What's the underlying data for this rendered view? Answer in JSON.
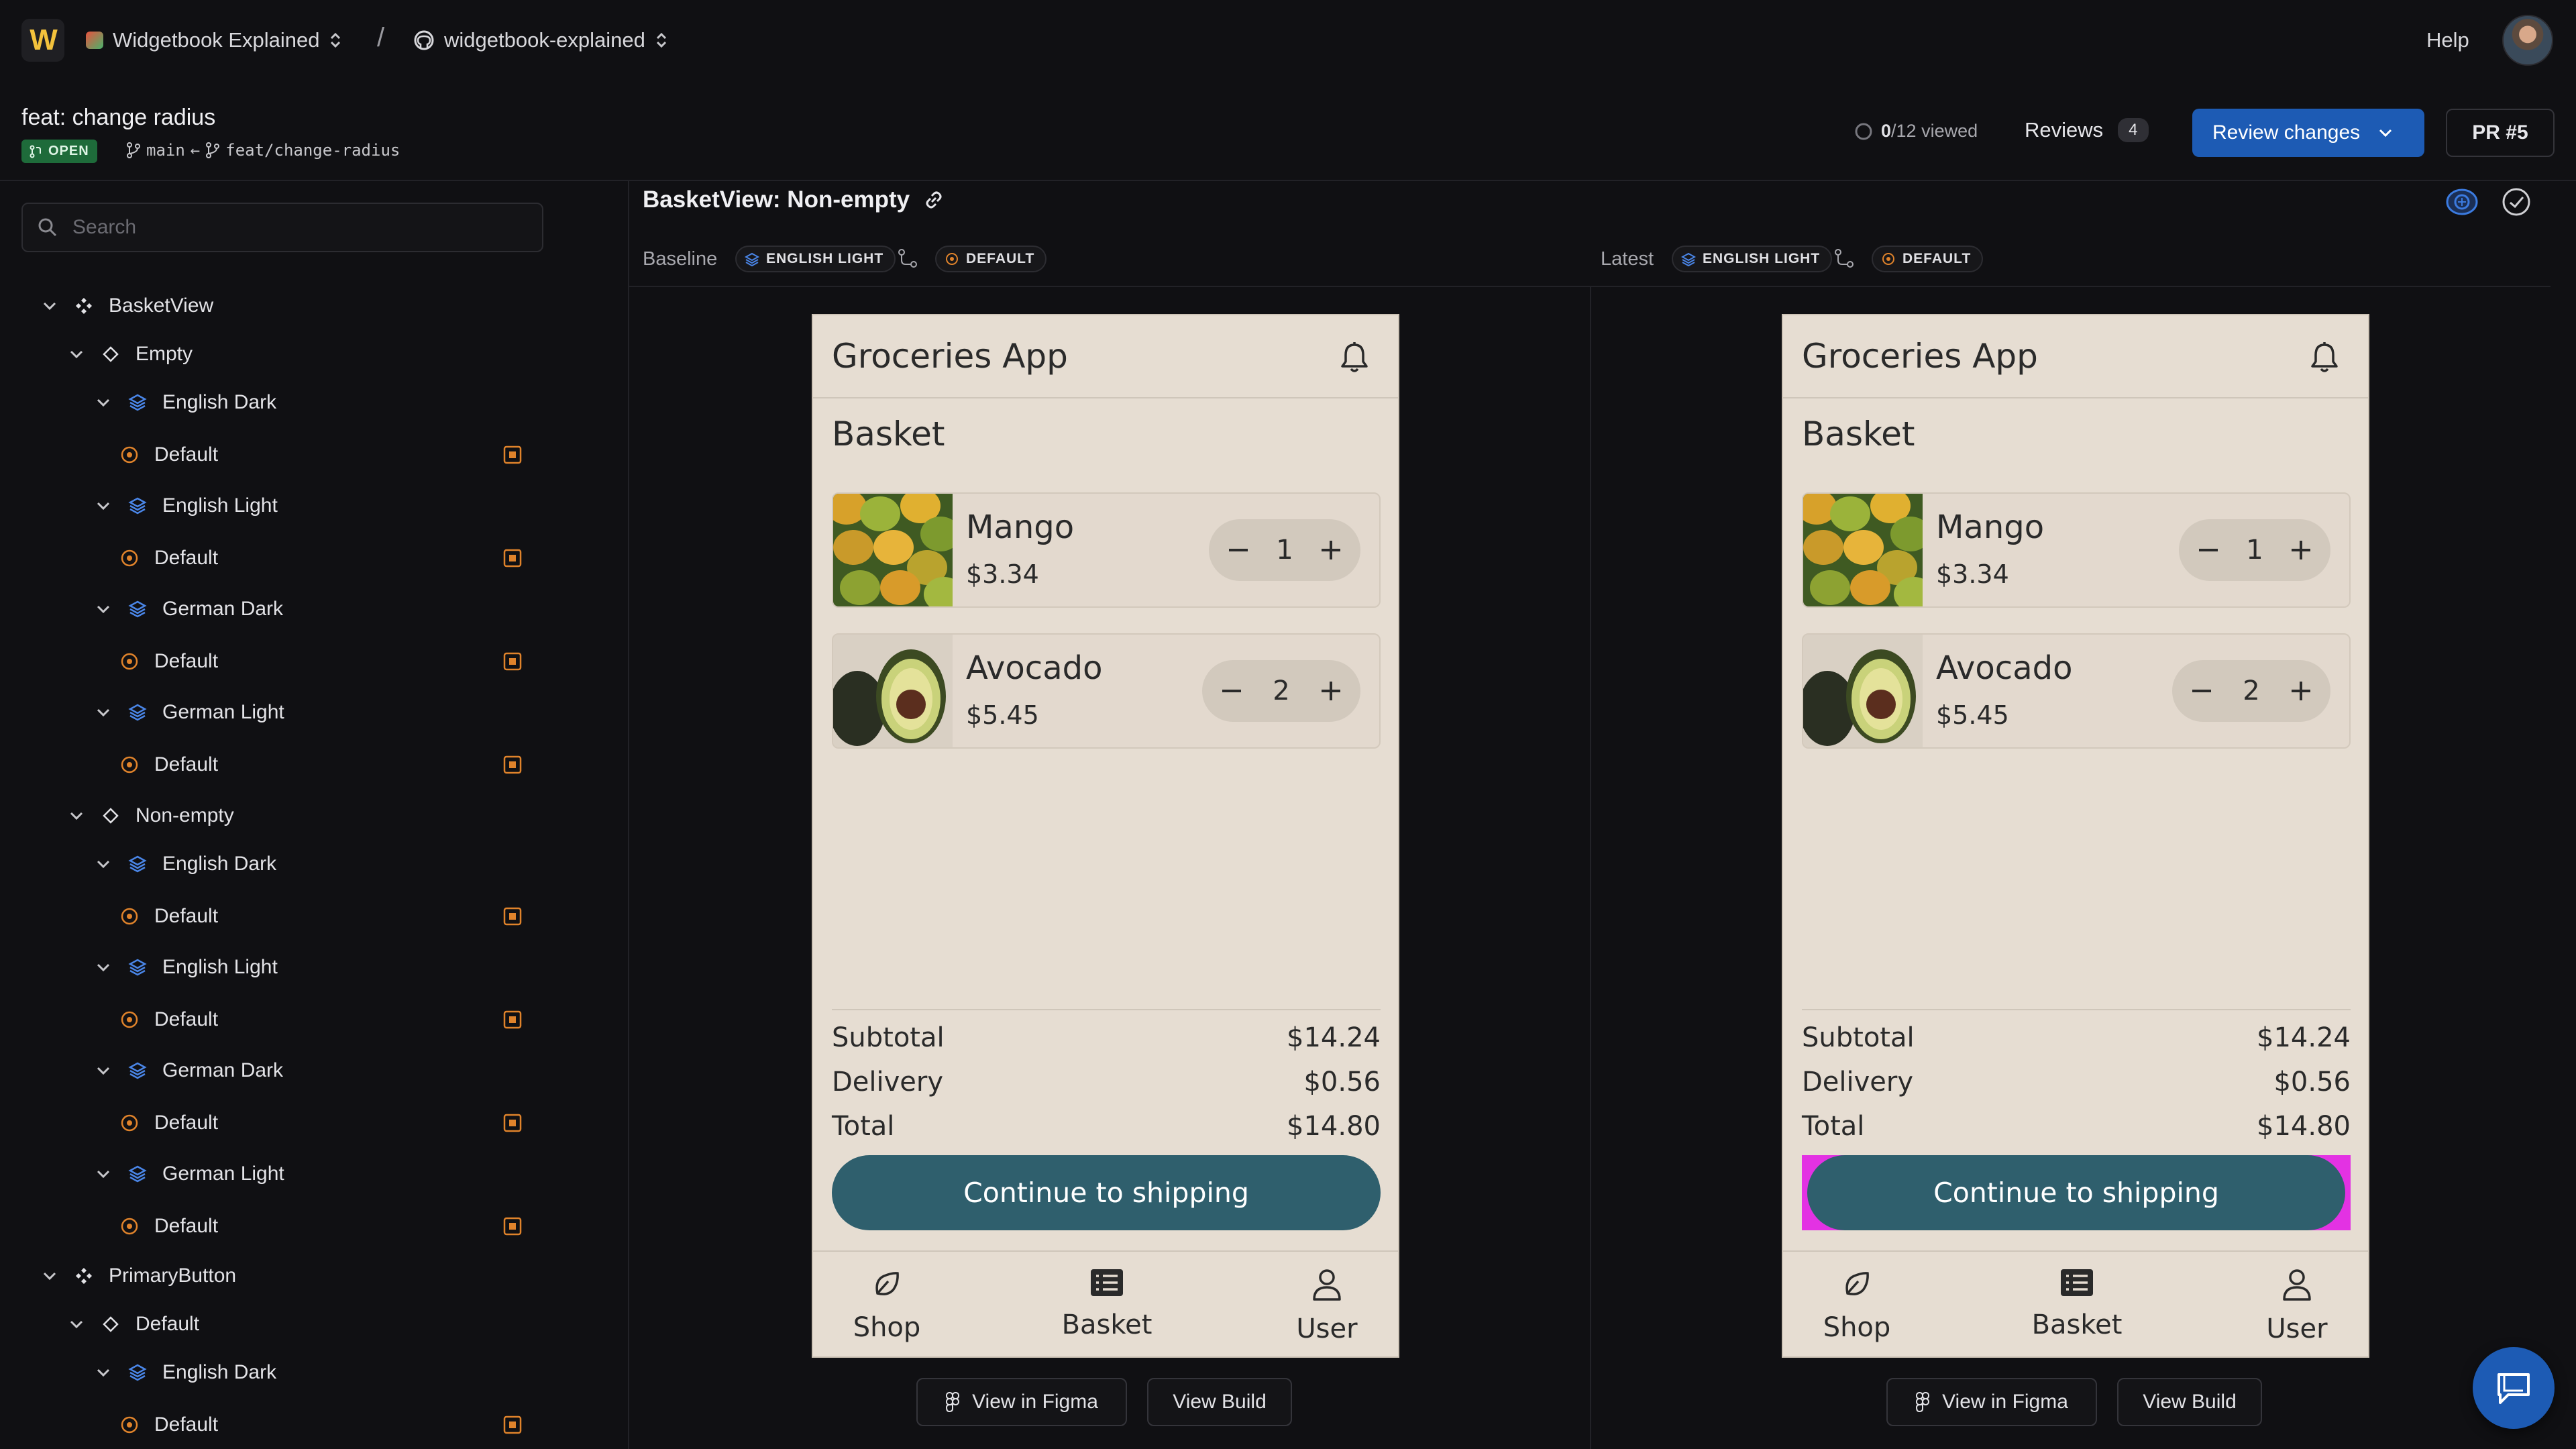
{
  "topbar": {
    "logo_text": "W",
    "workspace": "Widgetbook Explained",
    "separator": "/",
    "repo": "widgetbook-explained",
    "help": "Help"
  },
  "pr": {
    "title": "feat: change radius",
    "status": "OPEN",
    "base_branch": "main",
    "arrow": "←",
    "head_branch": "feat/change-radius",
    "viewed_count": "0",
    "viewed_total": "/12",
    "viewed_suffix": "viewed",
    "reviews_label": "Reviews",
    "reviews_count": "4",
    "review_button": "Review changes",
    "pr_button": "PR #5"
  },
  "search": {
    "placeholder": "Search"
  },
  "tree": {
    "basketview": "BasketView",
    "empty": "Empty",
    "nonempty": "Non-empty",
    "english_dark": "English Dark",
    "english_light": "English Light",
    "german_dark": "German Dark",
    "german_light": "German Light",
    "default": "Default",
    "primarybutton": "PrimaryButton"
  },
  "story": {
    "title": "BasketView: Non-empty",
    "baseline_label": "Baseline",
    "latest_label": "Latest",
    "locale_chip": "ENGLISH LIGHT",
    "theme_chip": "DEFAULT",
    "view_figma": "View in Figma",
    "view_build": "View Build"
  },
  "app": {
    "title": "Groceries App",
    "heading": "Basket",
    "items": [
      {
        "name": "Mango",
        "price": "$3.34",
        "qty": "1"
      },
      {
        "name": "Avocado",
        "price": "$5.45",
        "qty": "2"
      }
    ],
    "subtotal_label": "Subtotal",
    "subtotal": "$14.24",
    "delivery_label": "Delivery",
    "delivery": "$0.56",
    "total_label": "Total",
    "total": "$14.80",
    "cta": "Continue to shipping",
    "nav": {
      "shop": "Shop",
      "basket": "Basket",
      "user": "User"
    }
  },
  "colors": {
    "accent": "#1d5bb4",
    "open_badge": "#1e6b3a",
    "cta": "#2f5f6d",
    "diff_highlight": "#e332e3",
    "status_icon": "#e0832b",
    "phone_bg": "#e6ddd2"
  },
  "icons": {
    "logo": "widgetbook-logo",
    "repo": "github-icon",
    "tree_component": "component-icon",
    "tree_story": "diamond-icon",
    "tree_locale": "layers-icon",
    "tree_default": "target-icon",
    "diff_status": "changed-square-icon",
    "bell": "bell-icon"
  }
}
